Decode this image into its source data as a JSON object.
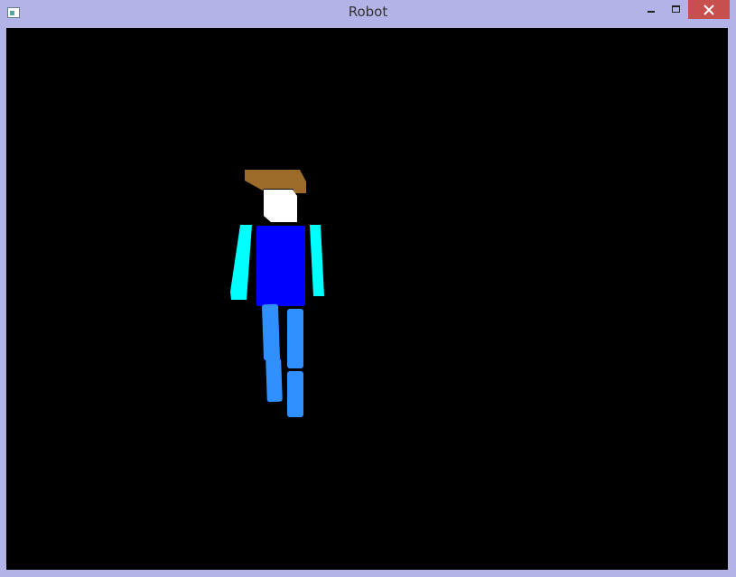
{
  "window": {
    "title": "Robot"
  },
  "controls": {
    "minimize_icon": "minimize-icon",
    "maximize_icon": "maximize-icon",
    "close_icon": "close-icon"
  },
  "colors": {
    "frame": "#b3b3e8",
    "close_button": "#c7504f",
    "background": "#000000",
    "hair": "#9c6b2a",
    "head": "#ffffff",
    "torso": "#0000ff",
    "arms": "#00ffff",
    "legs": "#3090ff"
  }
}
